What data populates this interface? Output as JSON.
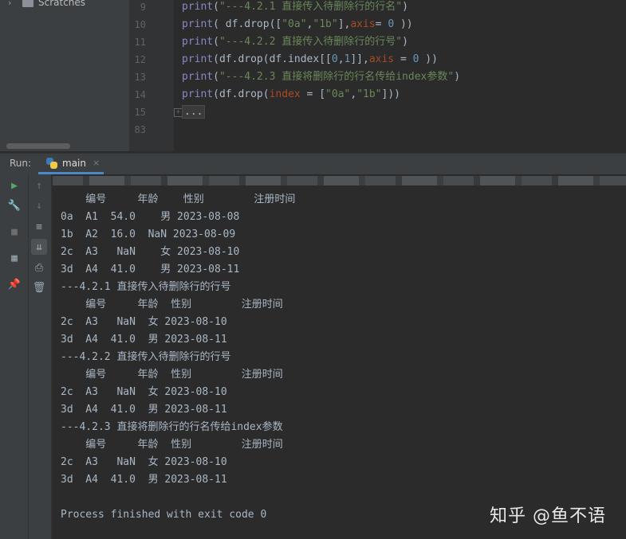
{
  "project": {
    "chevron": "›",
    "item": "Scratches"
  },
  "editor": {
    "line_numbers": [
      "9",
      "10",
      "11",
      "12",
      "13",
      "14",
      "15",
      "83"
    ],
    "lines": [
      [
        {
          "t": "print",
          "c": "kw"
        },
        {
          "t": "(",
          "c": "plain"
        },
        {
          "t": "\"---4.2.1 直接传入待删除行的行名\"",
          "c": "str"
        },
        {
          "t": ")",
          "c": "plain"
        }
      ],
      [
        {
          "t": "print",
          "c": "kw"
        },
        {
          "t": "( df.drop([",
          "c": "plain"
        },
        {
          "t": "\"0a\"",
          "c": "str"
        },
        {
          "t": ",",
          "c": "plain"
        },
        {
          "t": "\"1b\"",
          "c": "str"
        },
        {
          "t": "],",
          "c": "plain"
        },
        {
          "t": "axis",
          "c": "param"
        },
        {
          "t": "= ",
          "c": "plain"
        },
        {
          "t": "0",
          "c": "num"
        },
        {
          "t": " ))",
          "c": "plain"
        }
      ],
      [
        {
          "t": "print",
          "c": "kw"
        },
        {
          "t": "(",
          "c": "plain"
        },
        {
          "t": "\"---4.2.2 直接传入待删除行的行号\"",
          "c": "str"
        },
        {
          "t": ")",
          "c": "plain"
        }
      ],
      [
        {
          "t": "print",
          "c": "kw"
        },
        {
          "t": "(df.drop(df.index[[",
          "c": "plain"
        },
        {
          "t": "0",
          "c": "num"
        },
        {
          "t": ",",
          "c": "plain"
        },
        {
          "t": "1",
          "c": "num"
        },
        {
          "t": "]],",
          "c": "plain"
        },
        {
          "t": "axis",
          "c": "param"
        },
        {
          "t": " = ",
          "c": "plain"
        },
        {
          "t": "0",
          "c": "num"
        },
        {
          "t": " ))",
          "c": "plain"
        }
      ],
      [
        {
          "t": "print",
          "c": "kw"
        },
        {
          "t": "(",
          "c": "plain"
        },
        {
          "t": "\"---4.2.3 直接将删除行的行名传给index参数\"",
          "c": "str"
        },
        {
          "t": ")",
          "c": "plain"
        }
      ],
      [
        {
          "t": "print",
          "c": "kw"
        },
        {
          "t": "(df.drop(",
          "c": "plain"
        },
        {
          "t": "index",
          "c": "param"
        },
        {
          "t": " = [",
          "c": "plain"
        },
        {
          "t": "\"0a\"",
          "c": "str"
        },
        {
          "t": ",",
          "c": "plain"
        },
        {
          "t": "\"1b\"",
          "c": "str"
        },
        {
          "t": "]))",
          "c": "plain"
        }
      ],
      [
        {
          "t": "...",
          "c": "fold"
        }
      ]
    ]
  },
  "run": {
    "label": "Run:",
    "tab": "main",
    "close": "×"
  },
  "toolbar_left": [
    "▶",
    "🔧",
    "■",
    "▦",
    "📌"
  ],
  "toolbar_right": [
    "↑",
    "↓",
    "≡",
    "⇊",
    "⎙",
    "🗑"
  ],
  "console_lines": [
    "    编号     年龄    性别        注册时间",
    "0a  A1  54.0    男 2023-08-08",
    "1b  A2  16.0  NaN 2023-08-09",
    "2c  A3   NaN    女 2023-08-10",
    "3d  A4  41.0    男 2023-08-11",
    "---4.2.1 直接传入待删除行的行号",
    "    编号     年龄  性别        注册时间",
    "2c  A3   NaN  女 2023-08-10",
    "3d  A4  41.0  男 2023-08-11",
    "---4.2.2 直接传入待删除行的行号",
    "    编号     年龄  性别        注册时间",
    "2c  A3   NaN  女 2023-08-10",
    "3d  A4  41.0  男 2023-08-11",
    "---4.2.3 直接将删除行的行名传给index参数",
    "    编号     年龄  性别        注册时间",
    "2c  A3   NaN  女 2023-08-10",
    "3d  A4  41.0  男 2023-08-11",
    "",
    "Process finished with exit code 0"
  ],
  "watermark": "知乎 @鱼不语"
}
